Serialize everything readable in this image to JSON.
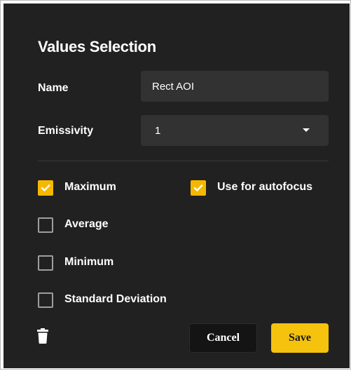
{
  "dialog": {
    "title": "Values Selection"
  },
  "fields": {
    "name_label": "Name",
    "name_value": "Rect AOI",
    "emissivity_label": "Emissivity",
    "emissivity_value": "1",
    "emissivity_icon": "caret-down-icon"
  },
  "checkboxes": {
    "maximum": {
      "label": "Maximum",
      "checked": true
    },
    "use_for_autofocus": {
      "label": "Use for autofocus",
      "checked": true
    },
    "average": {
      "label": "Average",
      "checked": false
    },
    "minimum": {
      "label": "Minimum",
      "checked": false
    },
    "standard_deviation": {
      "label": "Standard Deviation",
      "checked": false
    }
  },
  "actions": {
    "delete_icon": "trash-icon",
    "cancel_label": "Cancel",
    "save_label": "Save"
  },
  "colors": {
    "background": "#212121",
    "field_background": "#323232",
    "accent": "#f5c20d",
    "checkbox_border": "#9e9e9e"
  }
}
